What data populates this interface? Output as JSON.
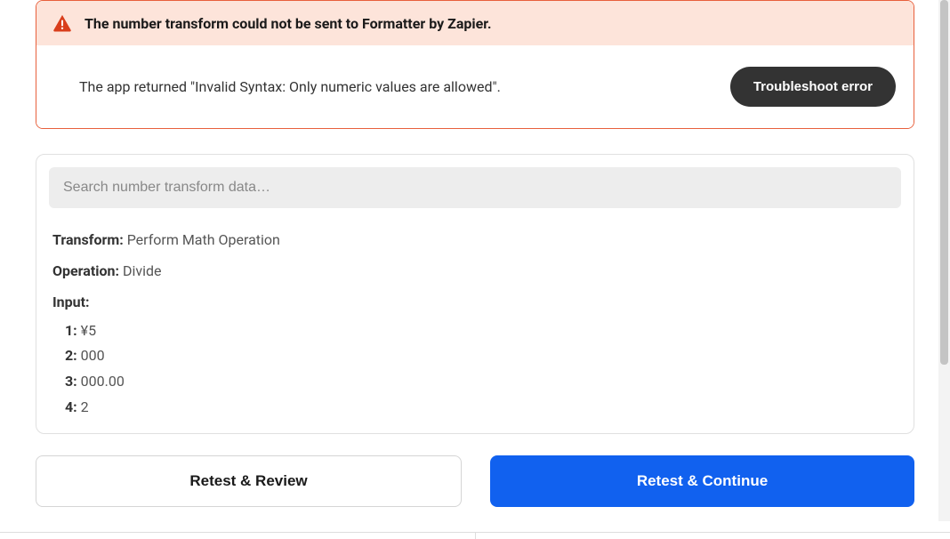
{
  "error": {
    "title": "The number transform could not be sent to Formatter by Zapier.",
    "message": "The app returned \"Invalid Syntax: Only numeric values are allowed\".",
    "troubleshoot_label": "Troubleshoot error"
  },
  "search": {
    "placeholder": "Search number transform data…"
  },
  "data": {
    "transform_label": "Transform:",
    "transform_value": " Perform Math Operation",
    "operation_label": "Operation:",
    "operation_value": " Divide",
    "input_label": "Input:",
    "inputs": [
      {
        "num": "1:",
        "val": " ¥5"
      },
      {
        "num": "2:",
        "val": " 000"
      },
      {
        "num": "3:",
        "val": " 000.00"
      },
      {
        "num": "4:",
        "val": " 2"
      }
    ]
  },
  "buttons": {
    "retest_review": "Retest & Review",
    "retest_continue": "Retest & Continue"
  }
}
